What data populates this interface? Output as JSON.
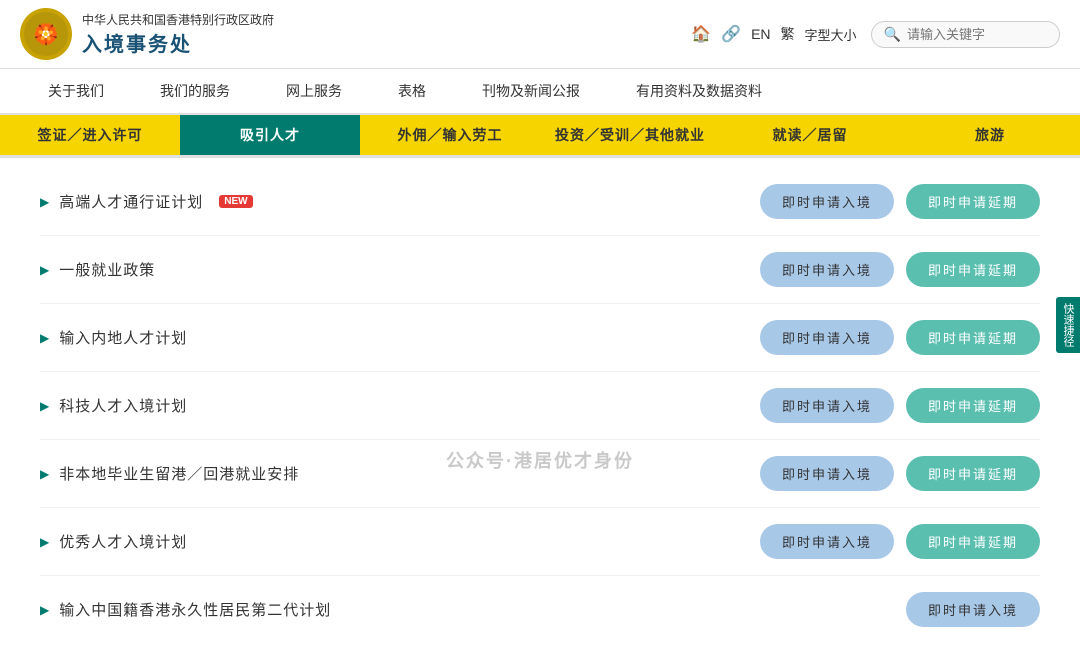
{
  "header": {
    "gov_name": "中华人民共和国香港特别行政区政府",
    "dept_name": "入境事务处",
    "logo_emoji": "🏵️",
    "home_icon": "🏠",
    "share_icon": "🔗",
    "lang_en": "EN",
    "lang_tc": "繁",
    "font_size": "字型大小",
    "search_placeholder": "请输入关键字"
  },
  "top_nav": {
    "items": [
      {
        "label": "关于我们"
      },
      {
        "label": "我们的服务"
      },
      {
        "label": "网上服务"
      },
      {
        "label": "表格"
      },
      {
        "label": "刊物及新闻公报"
      },
      {
        "label": "有用资料及数据资料"
      }
    ]
  },
  "sub_nav": {
    "items": [
      {
        "label": "签证／进入许可",
        "style": "yellow"
      },
      {
        "label": "吸引人才",
        "style": "teal"
      },
      {
        "label": "外佣／输入劳工",
        "style": "yellow"
      },
      {
        "label": "投资／受训／其他就业",
        "style": "yellow"
      },
      {
        "label": "就读／居留",
        "style": "yellow"
      },
      {
        "label": "旅游",
        "style": "yellow"
      }
    ]
  },
  "content": {
    "rows": [
      {
        "title": "高端人才通行证计划",
        "has_new": true,
        "btn1": "即时申请入境",
        "btn2": "即时申请延期"
      },
      {
        "title": "一般就业政策",
        "has_new": false,
        "btn1": "即时申请入境",
        "btn2": "即时申请延期"
      },
      {
        "title": "输入内地人才计划",
        "has_new": false,
        "btn1": "即时申请入境",
        "btn2": "即时申请延期"
      },
      {
        "title": "科技人才入境计划",
        "has_new": false,
        "btn1": "即时申请入境",
        "btn2": "即时申请延期"
      },
      {
        "title": "非本地毕业生留港／回港就业安排",
        "has_new": false,
        "btn1": "即时申请入境",
        "btn2": "即时申请延期"
      },
      {
        "title": "优秀人才入境计划",
        "has_new": false,
        "btn1": "即时申请入境",
        "btn2": "即时申请延期"
      },
      {
        "title": "输入中国籍香港永久性居民第二代计划",
        "has_new": false,
        "btn1": "即时申请入境",
        "btn2": ""
      }
    ],
    "new_label": "NEW",
    "scroll_hint": "快速捷径"
  },
  "watermark": {
    "text": "公众号·港居优才身份"
  }
}
